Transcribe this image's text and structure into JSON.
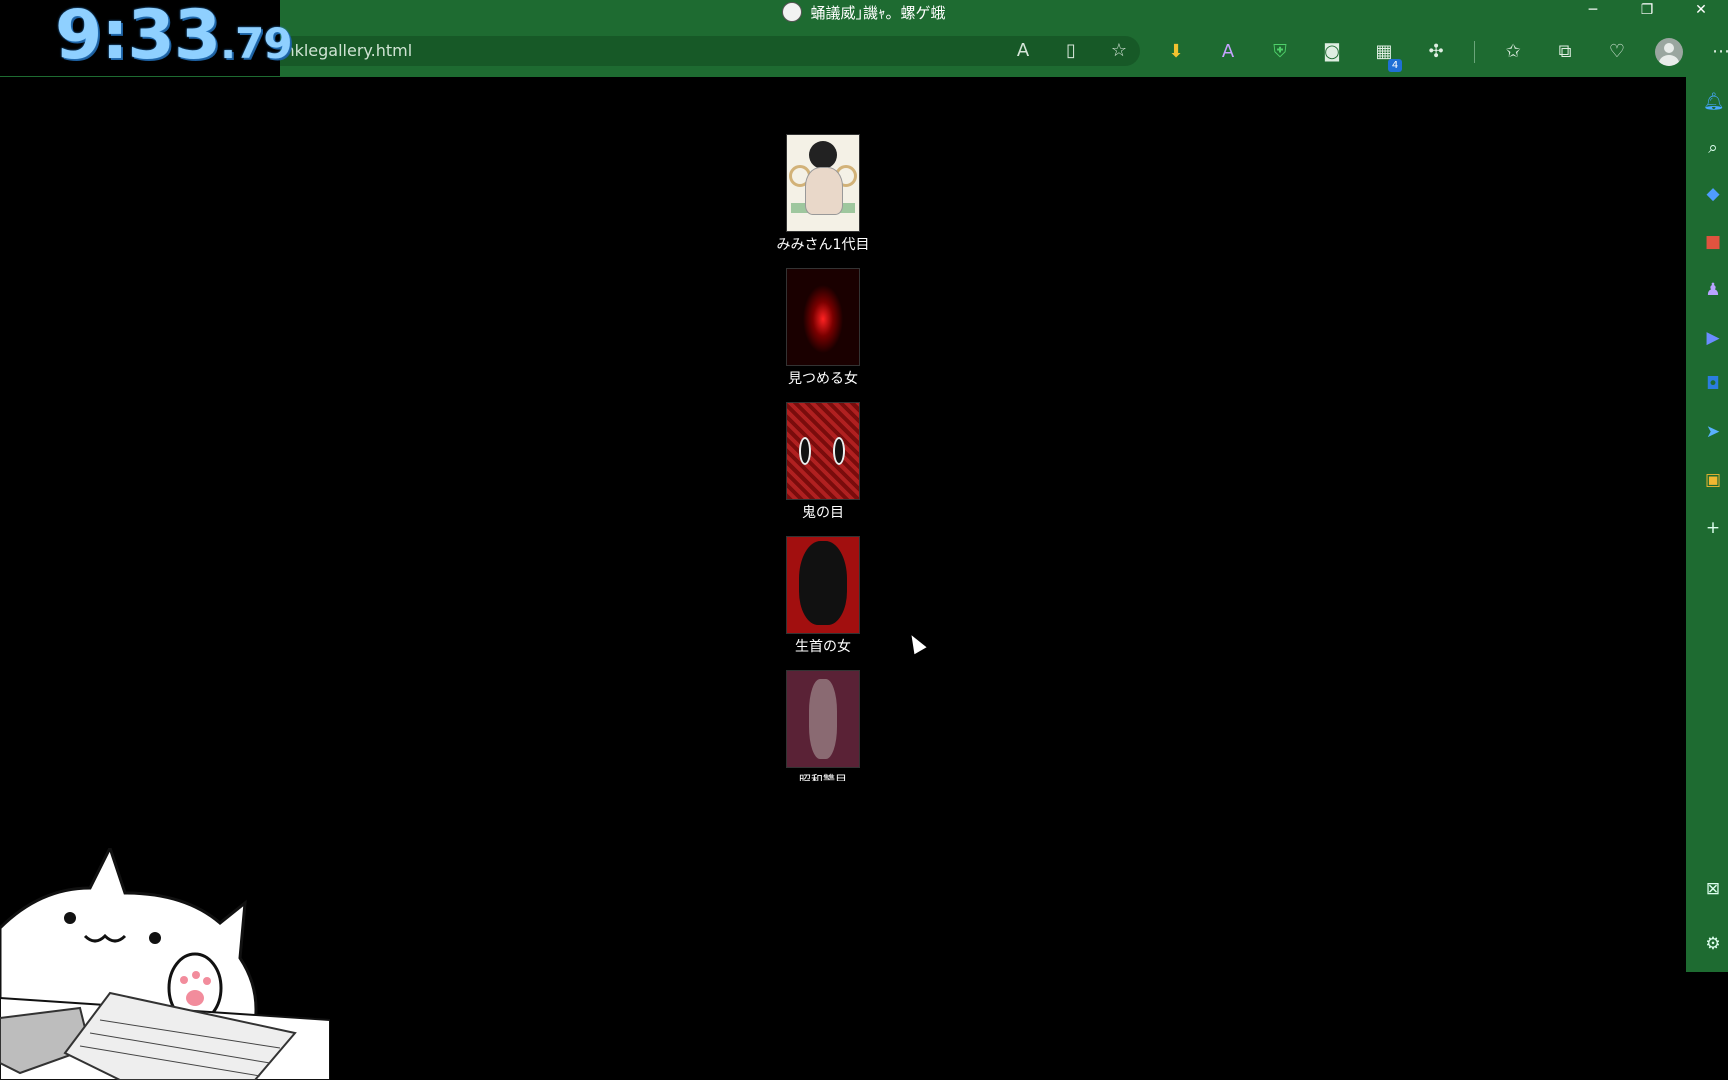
{
  "window": {
    "title": "蛹議威｣譏ｬ。螺ゲ蛾",
    "url_text": "inklegallery.html",
    "controls": [
      "─",
      "❐",
      "✕"
    ]
  },
  "timer": {
    "main": "9:33",
    "ms": ".79"
  },
  "toolbar": {
    "badge_count": "4"
  },
  "gallery": {
    "items": [
      {
        "caption": "みみさん1代目"
      },
      {
        "caption": "見つめる女"
      },
      {
        "caption": "鬼の目"
      },
      {
        "caption": "生首の女"
      },
      {
        "caption": "昭和讐目"
      }
    ]
  },
  "colors": {
    "chrome": "#1e6b31",
    "background": "#000000",
    "timer": "#8fd0ff"
  }
}
